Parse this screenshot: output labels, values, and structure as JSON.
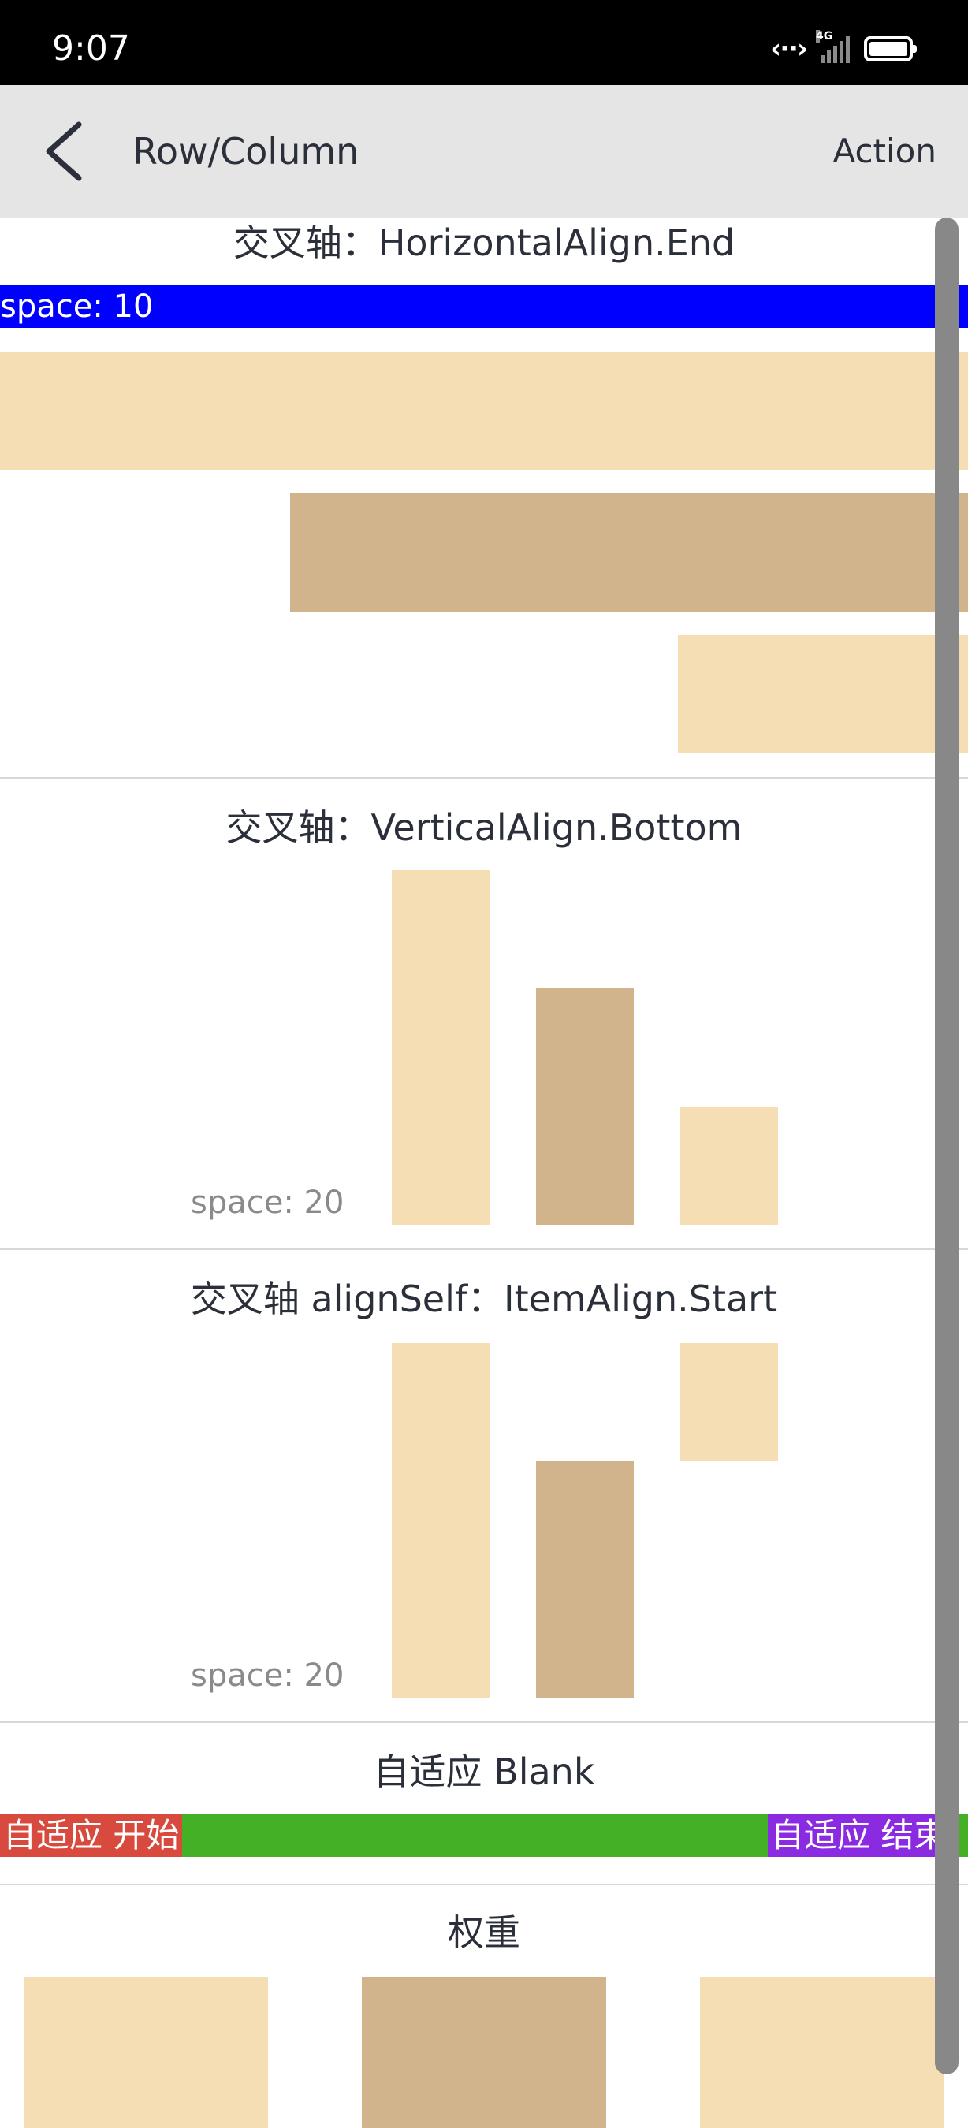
{
  "status_bar": {
    "time": "9:07",
    "network_label": "4G",
    "icons": [
      "data-transfer-icon",
      "signal-icon",
      "battery-icon"
    ]
  },
  "title_bar": {
    "title": "Row/Column",
    "action_label": "Action",
    "back_icon": "chevron-left-icon"
  },
  "sections": {
    "horizontal_align": {
      "title": "交叉轴：HorizontalAlign.End",
      "space_label": "space: 10"
    },
    "vertical_align": {
      "title": "交叉轴：VerticalAlign.Bottom",
      "space_label": "space: 20"
    },
    "align_self": {
      "title": "交叉轴 alignSelf：ItemAlign.Start",
      "space_label": "space: 20"
    },
    "blank": {
      "title": "自适应 Blank",
      "start_label": "自适应 开始",
      "end_label": "自适应 结束"
    },
    "weight": {
      "title": "权重"
    }
  },
  "colors": {
    "light_box": "#f5deb3",
    "dark_box": "#d2b48c",
    "space_bar": "#0000ff",
    "blank_fill": "#44b026",
    "blank_start": "#d94a3e",
    "blank_end": "#8a2be2",
    "title_bar": "#e5e5e5"
  }
}
